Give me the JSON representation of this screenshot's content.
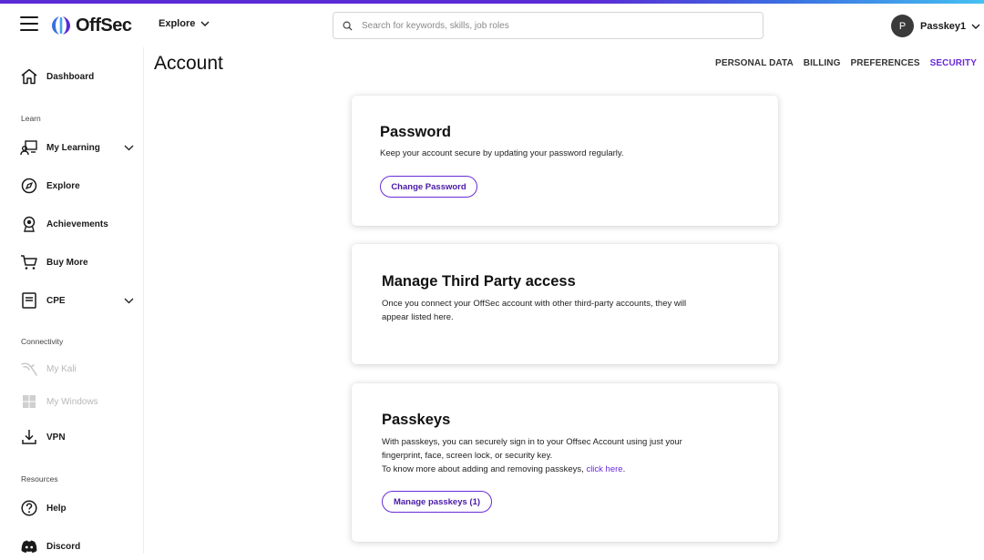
{
  "header": {
    "logo_text": "OffSec",
    "explore_label": "Explore",
    "search_placeholder": "Search for keywords, skills, job roles",
    "user_initial": "P",
    "user_name": "Passkey1"
  },
  "sidebar": {
    "dashboard": "Dashboard",
    "learn_section": "Learn",
    "my_learning": "My Learning",
    "explore": "Explore",
    "achievements": "Achievements",
    "buy_more": "Buy More",
    "cpe": "CPE",
    "connectivity_section": "Connectivity",
    "my_kali": "My Kali",
    "my_windows": "My Windows",
    "vpn": "VPN",
    "resources_section": "Resources",
    "help": "Help",
    "discord": "Discord"
  },
  "page": {
    "title": "Account",
    "tabs": [
      "PERSONAL DATA",
      "BILLING",
      "PREFERENCES",
      "SECURITY"
    ],
    "active_tab": "SECURITY"
  },
  "password_card": {
    "title": "Password",
    "description": "Keep your account secure by updating your password regularly.",
    "button": "Change Password"
  },
  "third_party_card": {
    "title": "Manage Third Party access",
    "description_line1": "Once you connect your OffSec account with other third-party accounts, they will",
    "description_line2": "appear listed here."
  },
  "passkeys_card": {
    "title": "Passkeys",
    "line1": "With passkeys, you can securely sign in to your Offsec Account using just your",
    "line2": "fingerprint, face, screen lock, or security key.",
    "line3_prefix": "To know more about adding and removing passkeys, ",
    "line3_link": "click here",
    "line3_suffix": ".",
    "button": "Manage passkeys (1)"
  },
  "colors": {
    "accent": "#6a2bd9",
    "text": "#1a1a1a",
    "disabled": "#b8b8b8"
  }
}
